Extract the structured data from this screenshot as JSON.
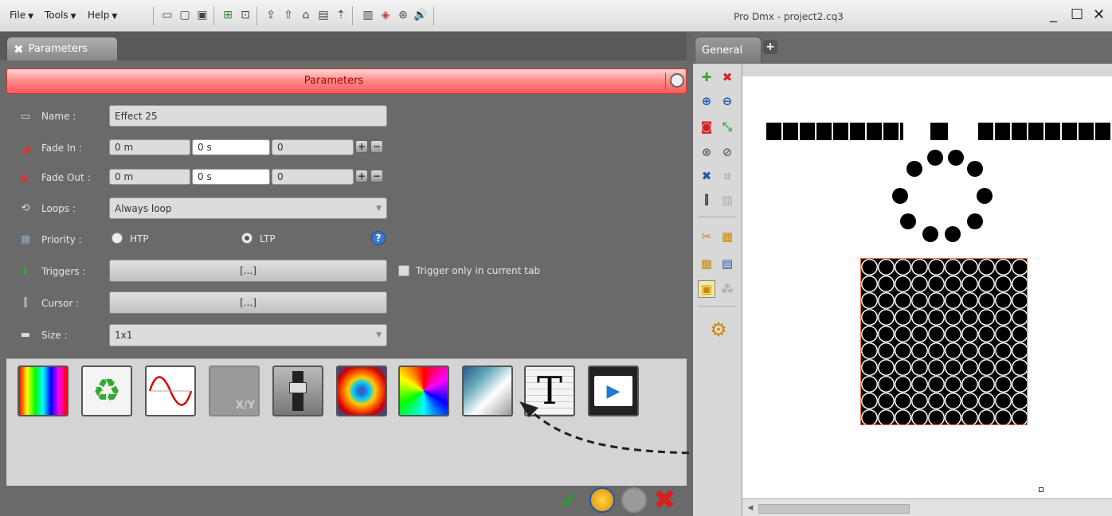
{
  "menu": {
    "file": "File",
    "tools": "Tools",
    "help": "Help",
    "arrow": "▼"
  },
  "app_title": "Pro Dmx - project2.cq3",
  "window_controls": {
    "minimize": "_",
    "maximize": "☐",
    "close": "✕"
  },
  "left_tab": {
    "label": "Parameters",
    "icon": "tools-icon"
  },
  "right_tab": {
    "label": "General",
    "add": "+"
  },
  "panel_title": "Parameters",
  "form": {
    "name_label": "Name :",
    "name_value": "Effect 25",
    "fadein_label": "Fade In :",
    "fadein_values": [
      "0 m",
      "0 s",
      "0"
    ],
    "fadeout_label": "Fade Out :",
    "fadeout_values": [
      "0 m",
      "0 s",
      "0"
    ],
    "plus": "+",
    "minus": "−",
    "loops_label": "Loops :",
    "loops_value": "Always loop",
    "priority_label": "Priority :",
    "priority_htp": "HTP",
    "priority_ltp": "LTP",
    "priority_selected": "LTP",
    "help": "?",
    "triggers_label": "Triggers :",
    "triggers_value": "[...]",
    "trigger_only_label": "Trigger only in current tab",
    "cursor_label": "Cursor :",
    "cursor_value": "[...]",
    "size_label": "Size :",
    "size_value": "1x1",
    "dropdown_arrow": "▼"
  },
  "effects": [
    {
      "name": "color-spectrum-icon"
    },
    {
      "name": "recycle-icon"
    },
    {
      "name": "sine-wave-icon"
    },
    {
      "name": "xy-pan-tilt-icon",
      "label": "X/Y",
      "disabled": true
    },
    {
      "name": "fader-icon"
    },
    {
      "name": "radial-gradient-icon"
    },
    {
      "name": "spiral-icon"
    },
    {
      "name": "picture-icon"
    },
    {
      "name": "text-icon",
      "label": "T"
    },
    {
      "name": "video-icon"
    }
  ],
  "colors": {
    "accent_red": "#ff5a5a",
    "header_text": "#b00000",
    "fixture_outline": "#ff6a3a"
  }
}
